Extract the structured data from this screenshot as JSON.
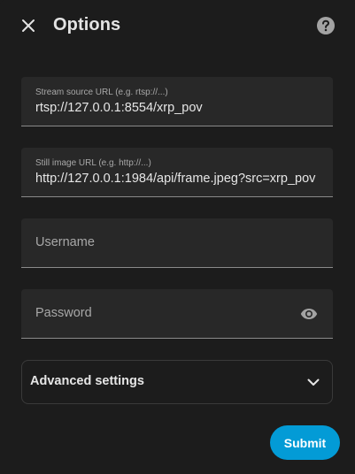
{
  "dialog": {
    "title": "Options",
    "close_icon": "close-icon",
    "help_icon": "help-circle-icon"
  },
  "fields": {
    "stream_source": {
      "label": "Stream source URL (e.g. rtsp://...)",
      "value": "rtsp://127.0.0.1:8554/xrp_pov"
    },
    "still_image": {
      "label": "Still image URL (e.g. http://...)",
      "value": "http://127.0.0.1:1984/api/frame.jpeg?src=xrp_pov"
    },
    "username": {
      "placeholder": "Username",
      "value": ""
    },
    "password": {
      "placeholder": "Password",
      "value": "",
      "visibility_icon": "eye-icon"
    }
  },
  "advanced": {
    "label": "Advanced settings",
    "expanded": false,
    "icon": "chevron-down-icon"
  },
  "actions": {
    "submit_label": "Submit"
  },
  "colors": {
    "background": "#1c1c1c",
    "field_background": "#282828",
    "primary": "#039bd6",
    "text": "#e6e6e6",
    "secondary_text": "#a8a8a8"
  }
}
